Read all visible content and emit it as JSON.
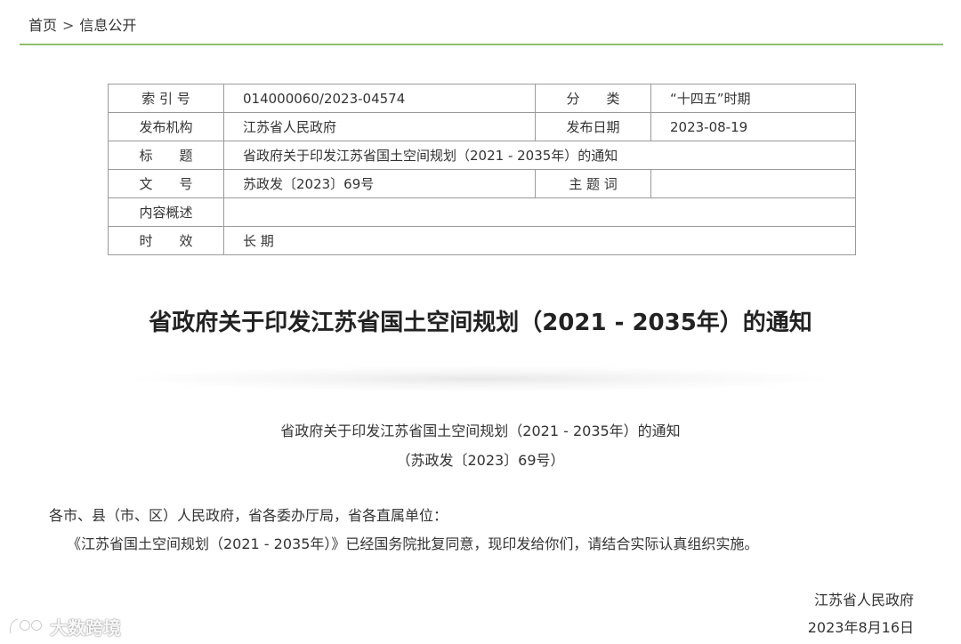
{
  "breadcrumb": {
    "home": "首页",
    "separator": ">",
    "current": "信息公开"
  },
  "meta_table": {
    "index_label": "索 引 号",
    "index_value": "014000060/2023-04574",
    "category_label": "分　　类",
    "category_value": "“十四五”时期",
    "publisher_label": "发布机构",
    "publisher_value": "江苏省人民政府",
    "date_label": "发布日期",
    "date_value": "2023-08-19",
    "title_label": "标　　题",
    "title_value": "省政府关于印发江苏省国土空间规划（2021 - 2035年）的通知",
    "docno_label": "文　　号",
    "docno_value": "苏政发〔2023〕69号",
    "subject_label": "主 题 词",
    "subject_value": "",
    "summary_label": "内容概述",
    "summary_value": "",
    "validity_label": "时　　效",
    "validity_value": "长 期"
  },
  "document": {
    "title": "省政府关于印发江苏省国土空间规划（2021 - 2035年）的通知",
    "subtitle": "省政府关于印发江苏省国土空间规划（2021 - 2035年）的通知",
    "doc_number": "（苏政发〔2023〕69号）",
    "salutation": "各市、县（市、区）人民政府，省各委办厅局，省各直属单位：",
    "body": "《江苏省国土空间规划（2021 - 2035年）》已经国务院批复同意，现印发给你们，请结合实际认真组织实施。",
    "signatory": "江苏省人民政府",
    "sign_date": "2023年8月16日"
  },
  "watermark": {
    "text": "大数跨境",
    "icon": "brand-logo-icon"
  },
  "colors": {
    "rule_green": "#8fbf6d",
    "table_border": "#9a9a9a",
    "text": "#333333"
  }
}
